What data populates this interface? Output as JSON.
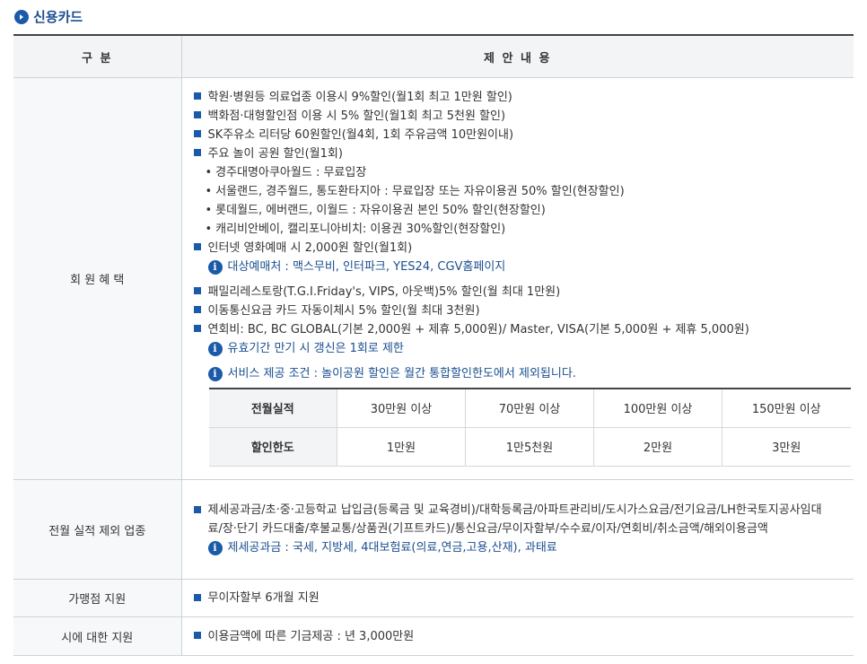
{
  "section_title": "신용카드",
  "table": {
    "headers": [
      "구 분",
      "제 안 내 용"
    ],
    "member_benefits": {
      "label": "회 원 혜 택",
      "items_a": [
        "학원·병원등 의료업종 이용시 9%할인(월1회 최고 1만원 할인)",
        "백화점·대형할인점 이용 시 5% 할인(월1회 최고 5천원 할인)",
        "SK주유소 리터당 60원할인(월4회, 1회 주유금액 10만원이내)",
        "주요 놀이 공원 할인(월1회)"
      ],
      "park_subitems": [
        "경주대명아쿠아월드 : 무료입장",
        "서울랜드, 경주월드, 통도환타지아 : 무료입장 또는 자유이용권 50% 할인(현장할인)",
        "롯데월드, 에버랜드, 이월드 : 자유이용권 본인 50% 할인(현장할인)",
        "캐리비안베이, 캘리포니아비치: 이용권 30%할인(현장할인)"
      ],
      "item_movie": "인터넷 영화예매 시 2,000원 할인(월1회)",
      "info_movie": "대상예매처 : 맥스무비, 인터파크, YES24, CGV홈페이지",
      "items_b": [
        "패밀리레스토랑(T.G.I.Friday's, VIPS, 아웃백)5% 할인(월 최대 1만원)",
        "이동통신요금 카드 자동이체시 5% 할인(월 최대 3천원)",
        "연회비: BC, BC GLOBAL(기본 2,000원 + 제휴 5,000원)/ Master, VISA(기본 5,000원 + 제휴 5,000원)"
      ],
      "info_validity": "유효기간 만기 시 갱신은 1회로 제한",
      "info_condition": "서비스 제공 조건 : 놀이공원 할인은 월간 통합할인한도에서 제외됩니다.",
      "limit_table": {
        "row1": [
          "전월실적",
          "30만원 이상",
          "70만원 이상",
          "100만원 이상",
          "150만원 이상"
        ],
        "row2": [
          "할인한도",
          "1만원",
          "1만5천원",
          "2만원",
          "3만원"
        ]
      }
    },
    "excluded": {
      "label": "전월 실적 제외 업종",
      "text": "제세공과금/초·중·고등학교 납입금(등록금 및 교육경비)/대학등록금/아파트관리비/도시가스요금/전기요금/LH한국토지공사임대료/장·단기 카드대출/후불교통/상품권(기프트카드)/통신요금/무이자할부/수수료/이자/연회비/취소금액/해외이용금액",
      "info": "제세공과금 : 국세, 지방세, 4대보험료(의료,연금,고용,산재), 과태료"
    },
    "merchant": {
      "label": "가맹점 지원",
      "text": "무이자할부 6개월 지원"
    },
    "city": {
      "label": "시에 대한 지원",
      "text": "이용금액에 따른 기금제공 : 년 3,000만원"
    }
  },
  "colors": {
    "accent": "#1a5aa8",
    "info_text": "#1a4f8f",
    "header_bg": "#f2f4f6"
  },
  "icons": [
    "arrow-circle-icon",
    "square-bullet-icon",
    "info-icon"
  ]
}
